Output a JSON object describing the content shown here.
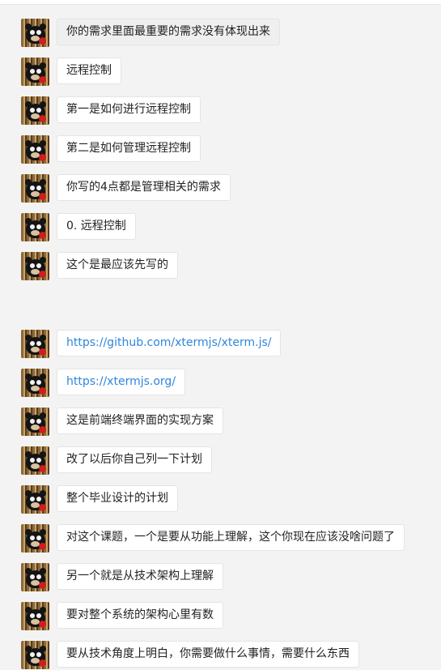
{
  "messages": [
    {
      "text": "你的需求里面最重要的需求没有体现出来",
      "link": false
    },
    {
      "text": "远程控制",
      "link": false
    },
    {
      "text": "第一是如何进行远程控制",
      "link": false
    },
    {
      "text": "第二是如何管理远程控制",
      "link": false
    },
    {
      "text": "你写的4点都是管理相关的需求",
      "link": false
    },
    {
      "text": "0. 远程控制",
      "link": false
    },
    {
      "text": "这个是最应该先写的",
      "link": false
    },
    {
      "text": "https://github.com/xtermjs/xterm.js/",
      "link": true
    },
    {
      "text": "https://xtermjs.org/",
      "link": true
    },
    {
      "text": "这是前端终端界面的实现方案",
      "link": false
    },
    {
      "text": "改了以后你自己列一下计划",
      "link": false
    },
    {
      "text": "整个毕业设计的计划",
      "link": false
    },
    {
      "text": "对这个课题，一个是要从功能上理解，这个你现在应该没啥问题了",
      "link": false
    },
    {
      "text": "另一个就是从技术架构上理解",
      "link": false
    },
    {
      "text": "要对整个系统的架构心里有数",
      "link": false
    },
    {
      "text": "要从技术角度上明白，你需要做什么事情，需要什么东西",
      "link": false
    }
  ],
  "colors": {
    "background": "#f3f3f3",
    "bubble": "#ffffff",
    "link": "#2e86de",
    "text": "#222222"
  },
  "icons": {
    "avatar": "kumamon-avatar"
  }
}
